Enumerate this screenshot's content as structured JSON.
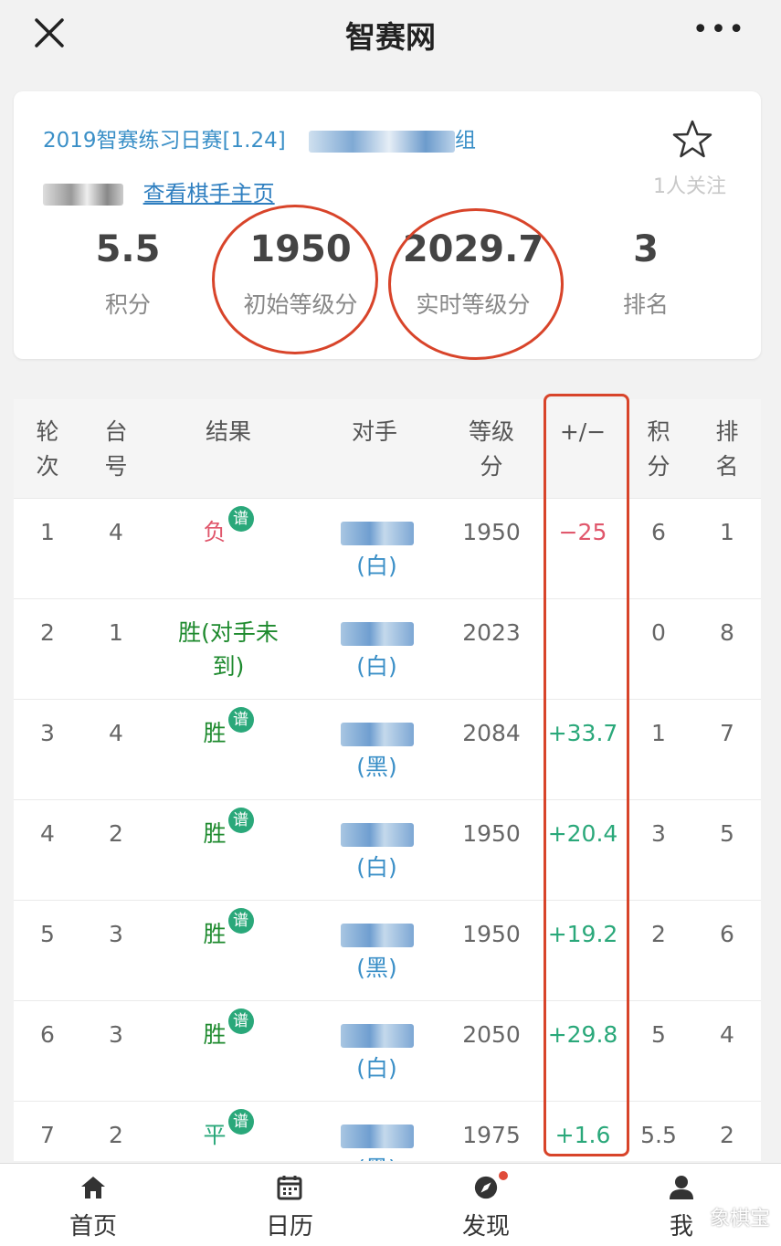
{
  "app": {
    "title": "智赛网"
  },
  "card": {
    "event_title": "2019智赛练习日赛[1.24]",
    "group_suffix": "组",
    "player_link": "查看棋手主页",
    "follow": "1人关注",
    "stats": [
      {
        "value": "5.5",
        "label": "积分"
      },
      {
        "value": "1950",
        "label": "初始等级分"
      },
      {
        "value": "2029.7",
        "label": "实时等级分"
      },
      {
        "value": "3",
        "label": "排名"
      }
    ]
  },
  "table": {
    "headers": [
      "轮\n次",
      "台\n号",
      "结果",
      "对手",
      "等级\n分",
      "+/−",
      "积\n分",
      "排\n名"
    ],
    "record_badge": "谱",
    "rows": [
      {
        "round": "1",
        "board": "4",
        "result": "负",
        "has_record": true,
        "color": "(白)",
        "rating": "1950",
        "delta": "−25",
        "points": "6",
        "rank": "1"
      },
      {
        "round": "2",
        "board": "1",
        "result": "胜(对手未到)",
        "has_record": false,
        "color": "(白)",
        "rating": "2023",
        "delta": "",
        "points": "0",
        "rank": "8"
      },
      {
        "round": "3",
        "board": "4",
        "result": "胜",
        "has_record": true,
        "color": "(黑)",
        "rating": "2084",
        "delta": "+33.7",
        "points": "1",
        "rank": "7"
      },
      {
        "round": "4",
        "board": "2",
        "result": "胜",
        "has_record": true,
        "color": "(白)",
        "rating": "1950",
        "delta": "+20.4",
        "points": "3",
        "rank": "5"
      },
      {
        "round": "5",
        "board": "3",
        "result": "胜",
        "has_record": true,
        "color": "(黑)",
        "rating": "1950",
        "delta": "+19.2",
        "points": "2",
        "rank": "6"
      },
      {
        "round": "6",
        "board": "3",
        "result": "胜",
        "has_record": true,
        "color": "(白)",
        "rating": "2050",
        "delta": "+29.8",
        "points": "5",
        "rank": "4"
      },
      {
        "round": "7",
        "board": "2",
        "result": "平",
        "has_record": true,
        "color": "(黑)",
        "rating": "1975",
        "delta": "+1.6",
        "points": "5.5",
        "rank": "2"
      }
    ]
  },
  "nav": {
    "items": [
      {
        "label": "首页",
        "icon": "home-icon"
      },
      {
        "label": "日历",
        "icon": "calendar-icon"
      },
      {
        "label": "发现",
        "icon": "compass-icon"
      },
      {
        "label": "我",
        "icon": "user-icon"
      }
    ]
  },
  "watermark": "象棋宝",
  "colors": {
    "loss": "#e0566b",
    "win": "#1e8a2e",
    "draw": "#2aa87a",
    "link": "#3a8fc7",
    "badge": "#2aa87a",
    "highlight": "#d8442a"
  }
}
